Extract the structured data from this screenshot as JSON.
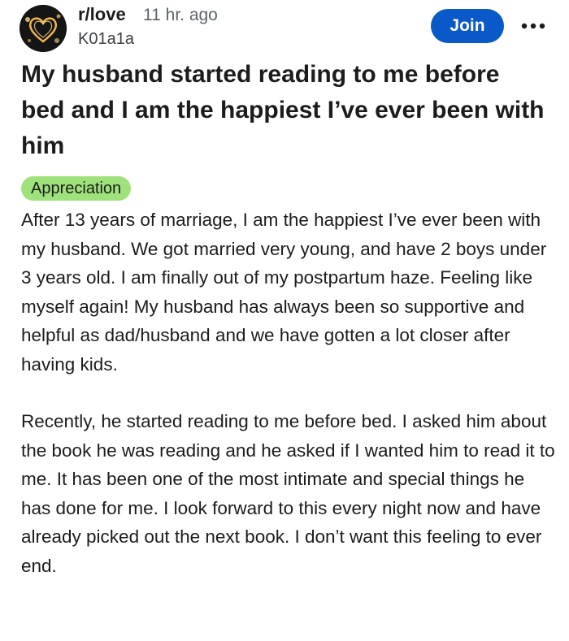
{
  "post": {
    "subreddit": "r/love",
    "time_ago": "11 hr. ago",
    "author": "K01a1a",
    "join_label": "Join",
    "more_icon": "more-horizontal-icon",
    "avatar_icon": "heart-bokeh-avatar",
    "title": "My husband started reading to me before bed and I am the happiest I’ve ever been with him",
    "flair": "Appreciation",
    "paragraphs": [
      "After 13 years of marriage, I am the happiest I’ve ever been with my husband. We got married very young, and have 2 boys under 3 years old. I am finally out of my postpartum haze. Feeling like myself again! My husband has always been so supportive and helpful as dad/husband and we have gotten a lot closer after having kids.",
      "Recently, he started reading to me before bed. I asked him about the book he was reading and he asked if I wanted him to read it to me. It has been one of the most intimate and special things he has done for me. I look forward to this every night now and have already picked out the next book. I don’t want this feeling to ever end."
    ]
  },
  "colors": {
    "join_button": "#0a59c8",
    "flair_background": "#9fe27b",
    "text": "#1c1c1c",
    "muted_text": "#5f6368"
  }
}
